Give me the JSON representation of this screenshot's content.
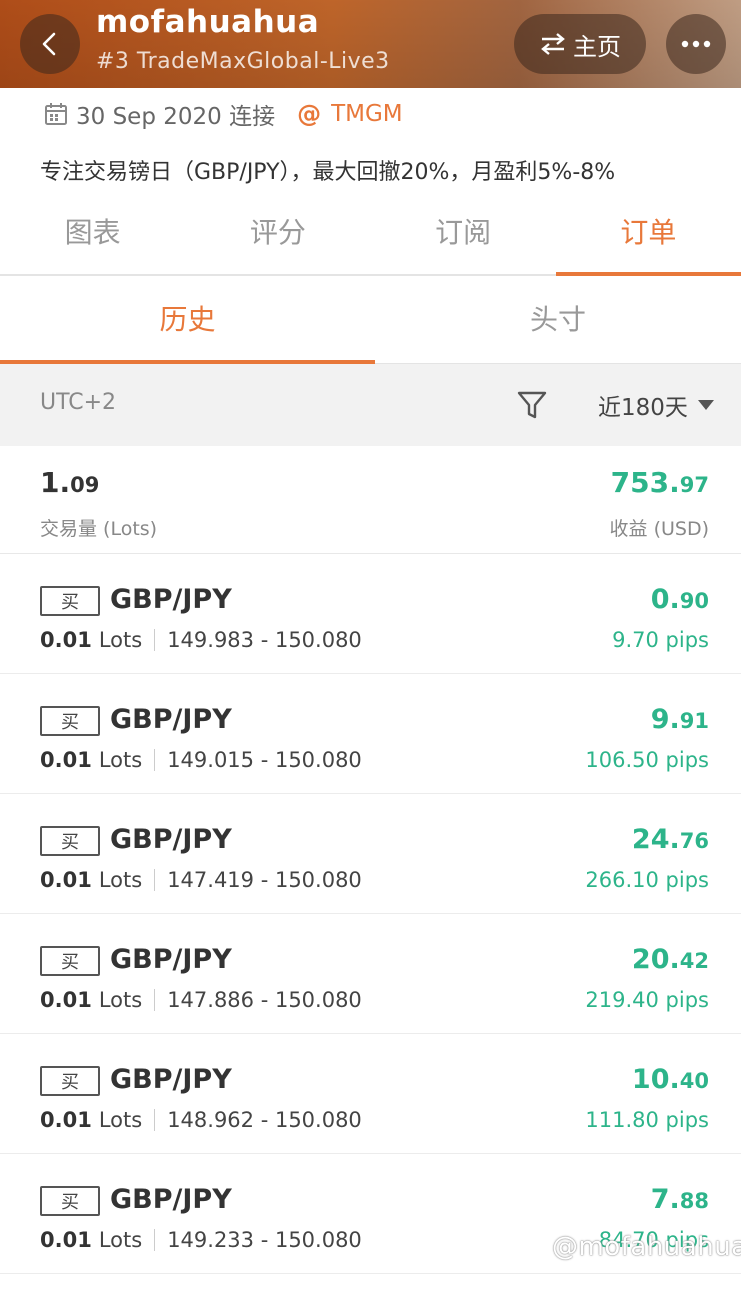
{
  "header": {
    "title": "mofahuahua",
    "subtitle": "#3 TradeMaxGlobal-Live3",
    "home_label": "主页"
  },
  "info": {
    "date": "30 Sep 2020 连接",
    "broker": "TMGM",
    "description": "专注交易镑日（GBP/JPY），最大回撤20%，月盈利5%-8%"
  },
  "main_tabs": [
    {
      "label": "图表",
      "active": false
    },
    {
      "label": "评分",
      "active": false
    },
    {
      "label": "订阅",
      "active": false
    },
    {
      "label": "订单",
      "active": true
    }
  ],
  "sub_tabs": [
    {
      "label": "历史",
      "active": true
    },
    {
      "label": "头寸",
      "active": false
    }
  ],
  "filter": {
    "timezone": "UTC+2",
    "period": "近180天"
  },
  "summary": {
    "lots_int": "1.",
    "lots_dec": "09",
    "lots_label": "交易量 (Lots)",
    "profit_int": "753.",
    "profit_dec": "97",
    "profit_label": "收益 (USD)"
  },
  "orders": [
    {
      "side": "买",
      "symbol": "GBP/JPY",
      "lots": "0.01",
      "lot_unit": "Lots",
      "range": "149.983 - 150.080",
      "profit_int": "0.",
      "profit_dec": "90",
      "pips": "9.70 pips"
    },
    {
      "side": "买",
      "symbol": "GBP/JPY",
      "lots": "0.01",
      "lot_unit": "Lots",
      "range": "149.015 - 150.080",
      "profit_int": "9.",
      "profit_dec": "91",
      "pips": "106.50 pips"
    },
    {
      "side": "买",
      "symbol": "GBP/JPY",
      "lots": "0.01",
      "lot_unit": "Lots",
      "range": "147.419 - 150.080",
      "profit_int": "24.",
      "profit_dec": "76",
      "pips": "266.10 pips"
    },
    {
      "side": "买",
      "symbol": "GBP/JPY",
      "lots": "0.01",
      "lot_unit": "Lots",
      "range": "147.886 - 150.080",
      "profit_int": "20.",
      "profit_dec": "42",
      "pips": "219.40 pips"
    },
    {
      "side": "买",
      "symbol": "GBP/JPY",
      "lots": "0.01",
      "lot_unit": "Lots",
      "range": "148.962 - 150.080",
      "profit_int": "10.",
      "profit_dec": "40",
      "pips": "111.80 pips"
    },
    {
      "side": "买",
      "symbol": "GBP/JPY",
      "lots": "0.01",
      "lot_unit": "Lots",
      "range": "149.233 - 150.080",
      "profit_int": "7.",
      "profit_dec": "88",
      "pips": "84.70 pips"
    }
  ],
  "watermark": "@mofahuahua",
  "colors": {
    "accent": "#e8783a",
    "profit": "#2db48a"
  }
}
